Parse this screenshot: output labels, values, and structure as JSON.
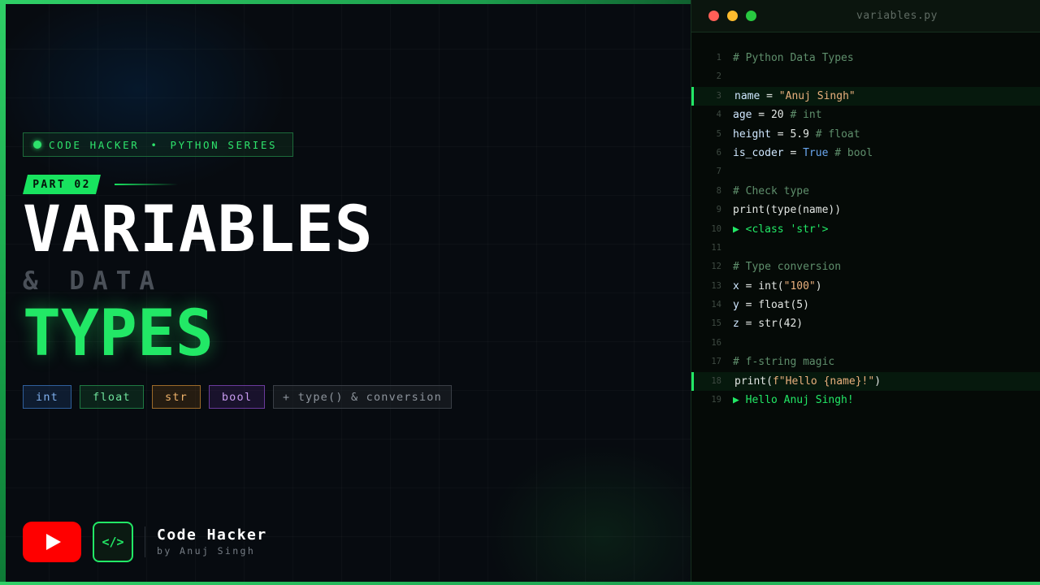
{
  "series_badge": {
    "channel": "CODE HACKER",
    "separator": "•",
    "series": "PYTHON SERIES"
  },
  "part_tag": "PART 02",
  "title": {
    "main": "VARIABLES",
    "sub": "& DATA",
    "accent": "TYPES"
  },
  "chips": [
    "int",
    "float",
    "str",
    "bool",
    "+ type() & conversion"
  ],
  "brand": {
    "logo_text": "</>",
    "name": "Code Hacker",
    "author": "by Anuj Singh"
  },
  "editor": {
    "file_name": "variables.py",
    "lines": [
      {
        "n": "1",
        "text": "# Python Data Types"
      },
      {
        "n": "2",
        "text": ""
      },
      {
        "n": "3",
        "text": "name = \"Anuj Singh\"",
        "highlight": true
      },
      {
        "n": "4",
        "text": "age = 20 # int"
      },
      {
        "n": "5",
        "text": "height = 5.9 # float"
      },
      {
        "n": "6",
        "text": "is_coder = True # bool"
      },
      {
        "n": "7",
        "text": ""
      },
      {
        "n": "8",
        "text": "# Check type"
      },
      {
        "n": "9",
        "text": "print(type(name))"
      },
      {
        "n": "10",
        "text": "▶ <class 'str'>"
      },
      {
        "n": "11",
        "text": ""
      },
      {
        "n": "12",
        "text": "# Type conversion"
      },
      {
        "n": "13",
        "text": "x = int(\"100\")"
      },
      {
        "n": "14",
        "text": "y = float(5)"
      },
      {
        "n": "15",
        "text": "z = str(42)"
      },
      {
        "n": "16",
        "text": ""
      },
      {
        "n": "17",
        "text": "# f-string magic"
      },
      {
        "n": "18",
        "text": "print(f\"Hello {name}!\")",
        "highlight": true
      },
      {
        "n": "19",
        "text": "▶ Hello Anuj Singh!"
      }
    ]
  },
  "colors": {
    "accent": "#22e866",
    "background": "#070b10",
    "youtube_red": "#ff0000"
  }
}
